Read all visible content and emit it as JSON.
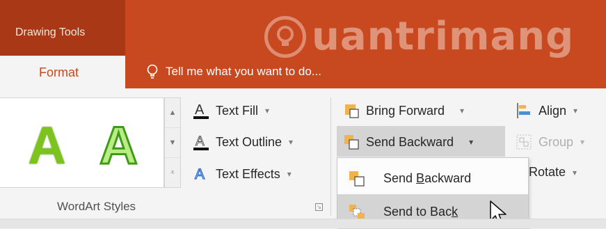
{
  "colors": {
    "accent": "#c8481f",
    "context_band": "#a83816",
    "ribbon_bg": "#f4f4f4",
    "wordart_green": "#7cc31e"
  },
  "header": {
    "context_title": "Drawing Tools",
    "active_tab": "Format",
    "tell_me": "Tell me what you want to do..."
  },
  "watermark": {
    "text": "uantrimang"
  },
  "wordart": {
    "gallery_items": [
      "A",
      "A"
    ],
    "text_fill": "Text Fill",
    "text_outline": "Text Outline",
    "text_effects": "Text Effects",
    "group_label": "WordArt Styles"
  },
  "arrange": {
    "bring_forward": "Bring Forward",
    "send_backward": "Send Backward",
    "align": "Align",
    "group": "Group",
    "rotate": "Rotate"
  },
  "dropdown_menu": {
    "item1": {
      "prefix": "Send ",
      "key": "B",
      "suffix": "ackward"
    },
    "item2": {
      "prefix": "Send to Bac",
      "key": "k",
      "suffix": ""
    }
  },
  "icons": [
    "lightbulb-icon",
    "text-fill-icon",
    "text-outline-icon",
    "text-effects-icon",
    "bring-forward-icon",
    "send-backward-icon",
    "send-to-back-icon",
    "align-icon",
    "group-icon",
    "mouse-cursor-icon"
  ]
}
